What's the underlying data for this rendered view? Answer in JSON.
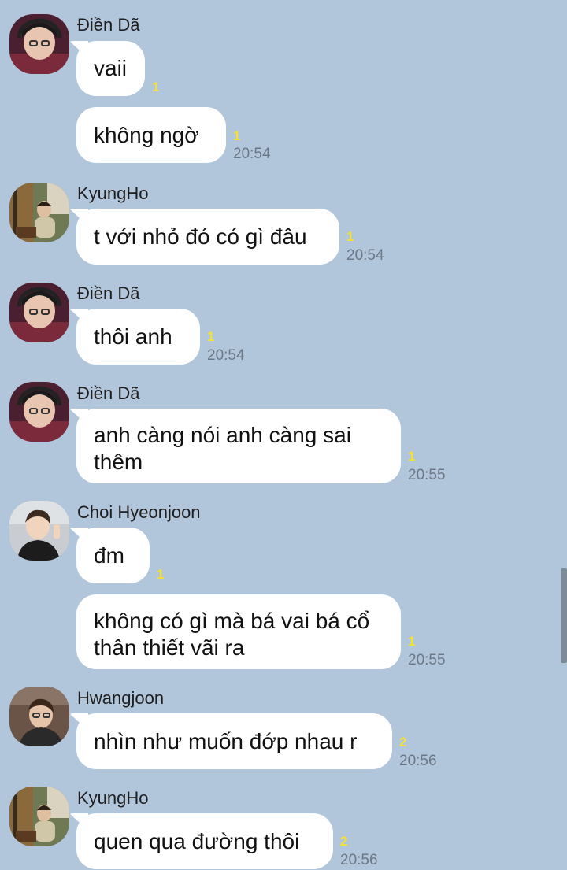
{
  "messages": [
    {
      "sender": "Điền Dã",
      "text": "vaii",
      "unread": "1",
      "time": ""
    },
    {
      "sender": "",
      "text": "không ngờ",
      "unread": "1",
      "time": "20:54"
    },
    {
      "sender": "KyungHo",
      "text": "t với nhỏ đó có gì đâu",
      "unread": "1",
      "time": "20:54"
    },
    {
      "sender": "Điền Dã",
      "text": "thôi anh",
      "unread": "1",
      "time": "20:54"
    },
    {
      "sender": "Điền Dã",
      "text_line1": "anh càng nói anh càng sai",
      "text_line2": "thêm",
      "unread": "1",
      "time": "20:55"
    },
    {
      "sender": "Choi Hyeonjoon",
      "text": "đm",
      "unread": "1",
      "time": ""
    },
    {
      "sender": "",
      "text_line1": "không có gì mà bá vai bá cổ",
      "text_line2": "thân thiết vãi ra",
      "unread": "1",
      "time": "20:55"
    },
    {
      "sender": "Hwangjoon",
      "text": "nhìn như muốn đớp nhau r",
      "unread": "2",
      "time": "20:56"
    },
    {
      "sender": "KyungHo",
      "text": "quen qua đường thôi",
      "unread": "2",
      "time": "20:56"
    }
  ],
  "colors": {
    "background": "#b1c5db",
    "bubble": "#ffffff",
    "unread": "#f4e232",
    "time": "#6c7886"
  }
}
